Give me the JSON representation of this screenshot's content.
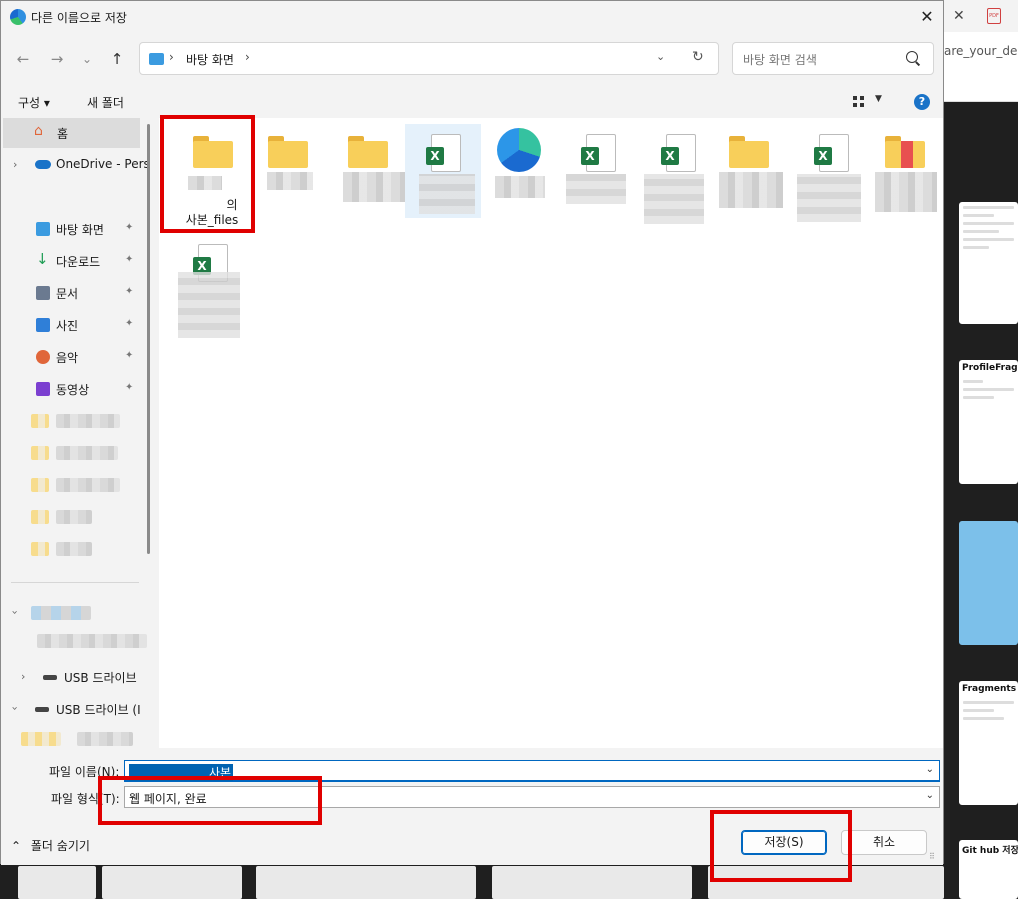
{
  "dialog": {
    "title": "다른 이름으로 저장",
    "close_label": "✕"
  },
  "background": {
    "url_fragment": "are_your_de",
    "cards": [
      {
        "title": ""
      },
      {
        "title": "ProfileFragme"
      },
      {
        "title": ""
      },
      {
        "title": "Fragments"
      },
      {
        "title": "Git hub 저장"
      }
    ]
  },
  "nav": {
    "back": "←",
    "forward": "→",
    "recent": "⌄",
    "up": "↑",
    "breadcrumb": "바탕 화면",
    "sep": "›",
    "dropdown": "⌄",
    "refresh": "↻"
  },
  "search": {
    "placeholder": "바탕 화면 검색"
  },
  "toolbar": {
    "organize": "구성 ▾",
    "new_folder": "새 폴더",
    "view_dropdown": "▼",
    "help": "?"
  },
  "sidebar": {
    "home": "홈",
    "onedrive": "OneDrive - Pers",
    "quick": [
      {
        "label": "바탕 화면",
        "color": "#3b9be0"
      },
      {
        "label": "다운로드",
        "color": "#1f9d55"
      },
      {
        "label": "문서",
        "color": "#6b7a90"
      },
      {
        "label": "사진",
        "color": "#2f7fd8"
      },
      {
        "label": "음악",
        "color": "#e0663a"
      },
      {
        "label": "동영상",
        "color": "#7b3fd0"
      }
    ],
    "usb1": "USB 드라이브",
    "usb2": "USB 드라이브 (I",
    "pin": "📌"
  },
  "files": [
    {
      "label": "의",
      "label2": "사본_files"
    }
  ],
  "form": {
    "filename_label": "파일 이름(N):",
    "filename_value": "사본",
    "filetype_label": "파일 형식(T):",
    "filetype_value": "웹 페이지, 완료",
    "dd": "⌄",
    "save": "저장(S)",
    "cancel": "취소",
    "hide_folders": "폴더 숨기기",
    "hide_chev": "⌃"
  },
  "colors": {
    "accent": "#0067c0",
    "annotation_red": "#e00000",
    "folder": "#f8cf5a"
  }
}
